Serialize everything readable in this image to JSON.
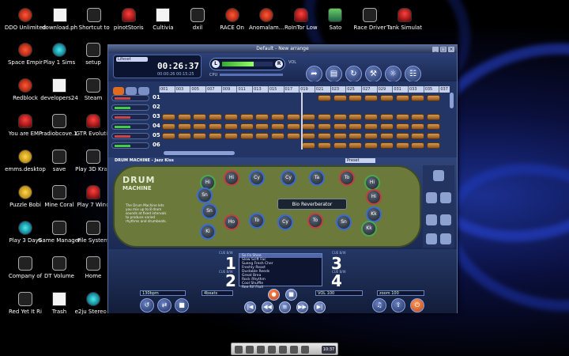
{
  "desktop": {
    "icons": [
      {
        "label": "DDO Unlimited",
        "glyph": "red",
        "icon": "ddo-icon"
      },
      {
        "label": "download.ph",
        "glyph": "doc",
        "icon": "document-icon"
      },
      {
        "label": "Shortcut to",
        "glyph": "dark",
        "icon": "shortcut-icon"
      },
      {
        "label": "pinotStoris",
        "glyph": "wine",
        "icon": "wine-icon"
      },
      {
        "label": "Cultivia",
        "glyph": "doc",
        "icon": "cultivia-icon"
      },
      {
        "label": "dxil",
        "glyph": "dark",
        "icon": "folder-icon"
      },
      {
        "label": "RACE On",
        "glyph": "red",
        "icon": "race-on-icon"
      },
      {
        "label": "Anomalam...",
        "glyph": "red",
        "icon": "arrow-icon"
      },
      {
        "label": "RoInTor Low",
        "glyph": "wine",
        "icon": "wine-icon"
      },
      {
        "label": "Sato",
        "glyph": "green",
        "icon": "sato-icon"
      },
      {
        "label": "Race Driver",
        "glyph": "dark",
        "icon": "race-driver-icon"
      },
      {
        "label": "Tank Simulat",
        "glyph": "wine",
        "icon": "wine-icon"
      },
      {
        "label": "Space Empir",
        "glyph": "red",
        "icon": "space-empire-icon"
      },
      {
        "label": "Play 1 Sims",
        "glyph": "cyan",
        "icon": "sims-icon"
      },
      {
        "label": "setup",
        "glyph": "dark",
        "icon": "setup-icon"
      },
      {
        "label": "Redblock",
        "glyph": "red",
        "icon": "redblock-icon"
      },
      {
        "label": "developers24",
        "glyph": "doc",
        "icon": "document-icon"
      },
      {
        "label": "Steam",
        "glyph": "dark",
        "icon": "steam-icon"
      },
      {
        "label": "You are EMP",
        "glyph": "wine",
        "icon": "wine-icon"
      },
      {
        "label": "radiobcove.1",
        "glyph": "dark",
        "icon": "radio-icon"
      },
      {
        "label": "GTR Evolutio",
        "glyph": "wine",
        "icon": "wine-icon"
      },
      {
        "label": "emms.desktop",
        "glyph": "yellow",
        "icon": "emms-icon"
      },
      {
        "label": "save",
        "glyph": "dark",
        "icon": "save-icon"
      },
      {
        "label": "Play 3D Kraft",
        "glyph": "dark",
        "icon": "kraft-icon"
      },
      {
        "label": "Puzzle Bobi",
        "glyph": "yellow",
        "icon": "puzzle-icon"
      },
      {
        "label": "Mine Coral",
        "glyph": "dark",
        "icon": "mine-icon"
      },
      {
        "label": "Play 7 Wind",
        "glyph": "wine",
        "icon": "wine-icon"
      },
      {
        "label": "Play 3 Days",
        "glyph": "cyan",
        "icon": "play-icon"
      },
      {
        "label": "Game Manager",
        "glyph": "dark",
        "icon": "game-manager-icon"
      },
      {
        "label": "File System",
        "glyph": "dark",
        "icon": "file-system-icon"
      },
      {
        "label": "Company of",
        "glyph": "dark",
        "icon": "company-icon"
      },
      {
        "label": "DT Volume",
        "glyph": "dark",
        "icon": "volume-icon"
      },
      {
        "label": "Home",
        "glyph": "dark",
        "icon": "home-icon"
      },
      {
        "label": "Red Yet It Ri",
        "glyph": "dark",
        "icon": "apple-icon"
      },
      {
        "label": "Trash",
        "glyph": "doc",
        "icon": "trash-icon"
      },
      {
        "label": "e2ju Stereo 6",
        "glyph": "cyan",
        "icon": "stereo-icon"
      }
    ]
  },
  "app": {
    "title": "Default - New arrange",
    "clock_field": "Lifeset",
    "time": "00:26:37",
    "time_sub": "00:00:26  00:15:25",
    "mixer_l": "L",
    "mixer_r": "R",
    "volume_label": "VOL",
    "mixer_level": 0.62,
    "cpu_label": "CPU",
    "top_buttons": [
      "➦",
      "▤",
      "↻",
      "⚒",
      "☼",
      "☷"
    ],
    "ruler": [
      "001",
      "003",
      "005",
      "007",
      "009",
      "011",
      "013",
      "015",
      "017",
      "019",
      "021",
      "023",
      "025",
      "027",
      "029",
      "031",
      "033",
      "035",
      "037"
    ],
    "tracks": [
      "01",
      "02",
      "03",
      "04",
      "05",
      "06"
    ],
    "drum": {
      "title": "DRUM MACHINE - Jazz Kiss",
      "preset": "Preset",
      "logo": "DRUM",
      "logo_sub": "MACHINE",
      "desc": "The Drum Machine lets you mix up to 8 drum sounds at fixed intervals to produce varied rhythms and drumbeats.",
      "fx": "Bio Reverberator",
      "pads": [
        "Hi",
        "Hi",
        "Cy",
        "Cy",
        "Ta",
        "To",
        "Hi",
        "Sn",
        "Hi",
        "Sn",
        "Kk",
        "Ho",
        "To",
        "Cy",
        "To",
        "Sn",
        "Kk",
        "Ki"
      ]
    },
    "decks": [
      {
        "num": "1",
        "label": "CUE B/W"
      },
      {
        "num": "2",
        "label": "CUE B/W"
      },
      {
        "num": "3",
        "label": "CUE B/W"
      },
      {
        "num": "4",
        "label": "CUE B/W"
      }
    ],
    "playlist": [
      "So Fa Shee",
      "Slow Scift Fac",
      "Sueng Fresh Cher",
      "Freshly Reast",
      "Dustable Reeds",
      "Great Brea",
      "Rock Rhythm",
      "Cool Shuffle",
      "Ree Rif Ftoll"
    ],
    "bpm": "130bpm",
    "beats": "4beats",
    "vol_field": "VOL 100",
    "zoom_field": "zoom 100",
    "transport": [
      "|◀",
      "◀◀",
      "≡",
      "▶▶",
      "▶|"
    ]
  },
  "taskbar": {
    "clock": "10:37"
  }
}
